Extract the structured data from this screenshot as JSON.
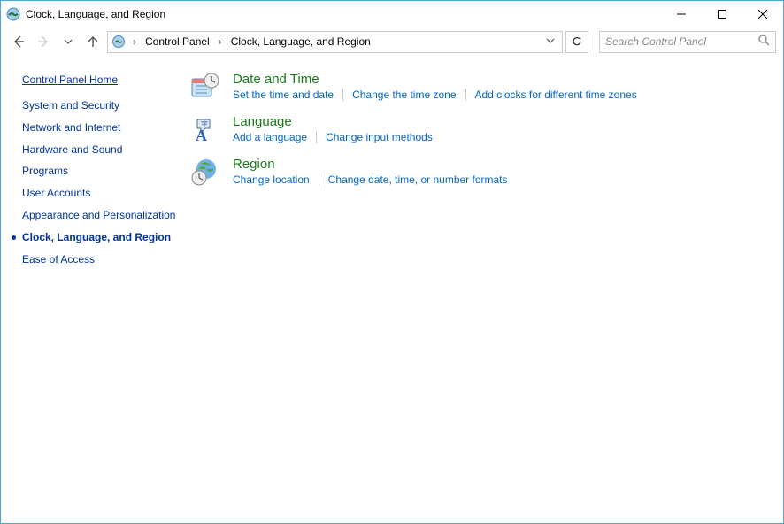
{
  "window": {
    "title": "Clock, Language, and Region"
  },
  "nav": {
    "breadcrumb": {
      "root": "Control Panel",
      "current": "Clock, Language, and Region"
    },
    "search_placeholder": "Search Control Panel"
  },
  "sidebar": {
    "home": "Control Panel Home",
    "items": [
      {
        "label": "System and Security"
      },
      {
        "label": "Network and Internet"
      },
      {
        "label": "Hardware and Sound"
      },
      {
        "label": "Programs"
      },
      {
        "label": "User Accounts"
      },
      {
        "label": "Appearance and Personalization"
      },
      {
        "label": "Clock, Language, and Region",
        "active": true
      },
      {
        "label": "Ease of Access"
      }
    ]
  },
  "main": {
    "categories": [
      {
        "title": "Date and Time",
        "icon": "datetime",
        "tasks": [
          "Set the time and date",
          "Change the time zone",
          "Add clocks for different time zones"
        ]
      },
      {
        "title": "Language",
        "icon": "language",
        "tasks": [
          "Add a language",
          "Change input methods"
        ]
      },
      {
        "title": "Region",
        "icon": "region",
        "tasks": [
          "Change location",
          "Change date, time, or number formats"
        ]
      }
    ]
  }
}
